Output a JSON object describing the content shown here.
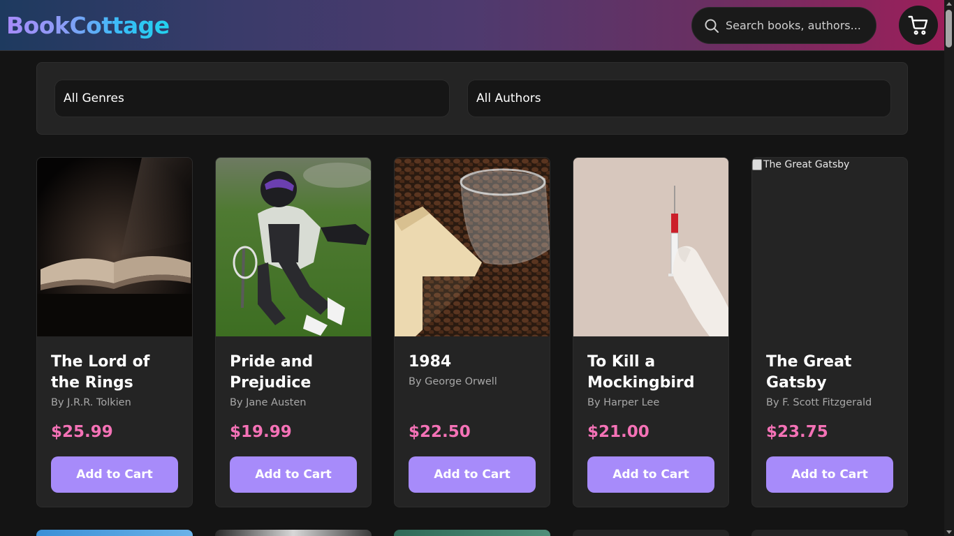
{
  "header": {
    "logo": "BookCottage",
    "search_placeholder": "Search books, authors..."
  },
  "filters": {
    "genre_label": "All Genres",
    "author_label": "All Authors"
  },
  "books": [
    {
      "title": "The Lord of the Rings",
      "author": "By J.R.R. Tolkien",
      "price": "$25.99",
      "button": "Add to Cart",
      "image": "open-book-photo"
    },
    {
      "title": "Pride and Prejudice",
      "author": "By Jane Austen",
      "price": "$19.99",
      "button": "Add to Cart",
      "image": "lacrosse-player-photo"
    },
    {
      "title": "1984",
      "author": "By George Orwell",
      "price": "$22.50",
      "button": "Add to Cart",
      "image": "coffee-beans-photo"
    },
    {
      "title": "To Kill a Mockingbird",
      "author": "By Harper Lee",
      "price": "$21.00",
      "button": "Add to Cart",
      "image": "syringe-hand-photo"
    },
    {
      "title": "The Great Gatsby",
      "author": "By F. Scott Fitzgerald",
      "price": "$23.75",
      "button": "Add to Cart",
      "image": "broken-image",
      "image_alt": "The Great Gatsby"
    }
  ],
  "colors": {
    "accent": "#a78bfa",
    "price": "#f472b6",
    "background": "#141414",
    "card": "#242424"
  }
}
